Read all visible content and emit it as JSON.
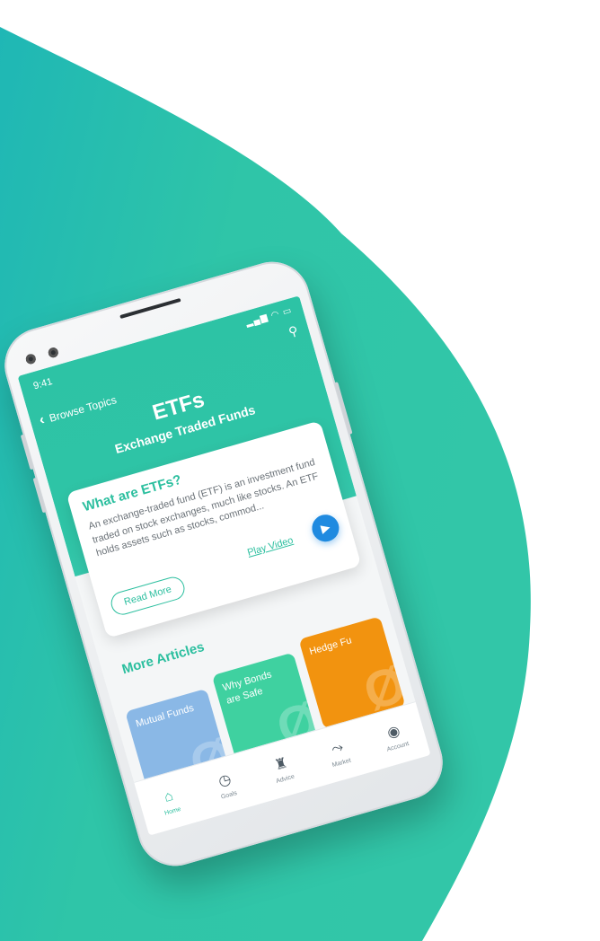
{
  "colors": {
    "accent": "#2dc3a5",
    "play": "#1f8ae0",
    "background": "#2fc5a8"
  },
  "status": {
    "time": "9:41",
    "icons": "signal wifi battery"
  },
  "header": {
    "back_label": "Browse Topics",
    "title": "ETFs",
    "subtitle": "Exchange Traded Funds"
  },
  "card": {
    "heading": "What are ETFs?",
    "body": "An exchange-traded fund (ETF) is an investment fund traded on stock exchanges, much like stocks. An ETF holds assets such as stocks, commod...",
    "read_more": "Read More",
    "play_video": "Play Video"
  },
  "articles": {
    "heading": "More Articles",
    "items": [
      {
        "label": "Mutual Funds",
        "color": "#8ab8e6"
      },
      {
        "label": "Why Bonds are Safe",
        "color": "#3fd1a0"
      },
      {
        "label": "Hedge Fu",
        "color": "#f2930f"
      }
    ]
  },
  "nav": {
    "items": [
      {
        "label": "Home",
        "icon": "home-icon"
      },
      {
        "label": "Goals",
        "icon": "clock-icon"
      },
      {
        "label": "Advice",
        "icon": "advisor-icon"
      },
      {
        "label": "Market",
        "icon": "market-icon"
      },
      {
        "label": "Account",
        "icon": "account-icon"
      }
    ]
  }
}
